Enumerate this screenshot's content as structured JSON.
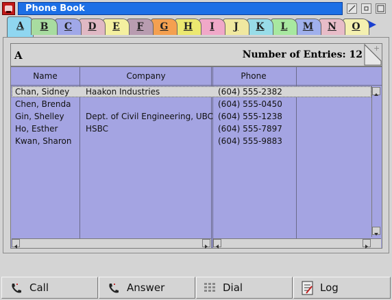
{
  "window": {
    "title": "Phone Book"
  },
  "tabs": [
    {
      "label": "A",
      "color": "#8fd6f0",
      "active": true
    },
    {
      "label": "B",
      "color": "#a8dca0"
    },
    {
      "label": "C",
      "color": "#a0a8e8"
    },
    {
      "label": "D",
      "color": "#e0b8c4"
    },
    {
      "label": "E",
      "color": "#f4f0a0"
    },
    {
      "label": "F",
      "color": "#b89cb0"
    },
    {
      "label": "G",
      "color": "#f4a050"
    },
    {
      "label": "H",
      "color": "#ece870"
    },
    {
      "label": "I",
      "color": "#f0a8c8"
    },
    {
      "label": "J",
      "color": "#f0e8a0"
    },
    {
      "label": "K",
      "color": "#98dce8"
    },
    {
      "label": "L",
      "color": "#a8e8a0"
    },
    {
      "label": "M",
      "color": "#a0b0ec"
    },
    {
      "label": "N",
      "color": "#e8bcc8"
    },
    {
      "label": "O",
      "color": "#f4f0b0"
    }
  ],
  "header": {
    "letter": "A",
    "count_label": "Number of Entries: 12"
  },
  "columns": {
    "name": "Name",
    "company": "Company",
    "phone": "Phone"
  },
  "rows": [
    {
      "name": "Chan, Sidney",
      "company": "Haakon Industries",
      "phone": "(604) 555-2382"
    },
    {
      "name": "Chen, Brenda",
      "company": "",
      "phone": "(604) 555-0450"
    },
    {
      "name": "Gin, Shelley",
      "company": "Dept. of Civil Engineering, UBC",
      "phone": "(604) 555-1238"
    },
    {
      "name": "Ho, Esther",
      "company": "HSBC",
      "phone": "(604) 555-7897"
    },
    {
      "name": "Kwan, Sharon",
      "company": "",
      "phone": "(604) 555-9883"
    }
  ],
  "buttons": {
    "call": "Call",
    "answer": "Answer",
    "dial": "Dial",
    "log": "Log"
  },
  "colors": {
    "title_bar": "#1c6fe6",
    "grid_bg": "#a4a4e2",
    "next_arrow": "#1a3fd0"
  },
  "icons": {
    "app": "phone-book-icon",
    "next_tabs": "right-arrow-icon",
    "call": "phone-handset-icon",
    "answer": "phone-handset-icon",
    "dial": "keypad-icon",
    "log": "log-book-icon"
  }
}
